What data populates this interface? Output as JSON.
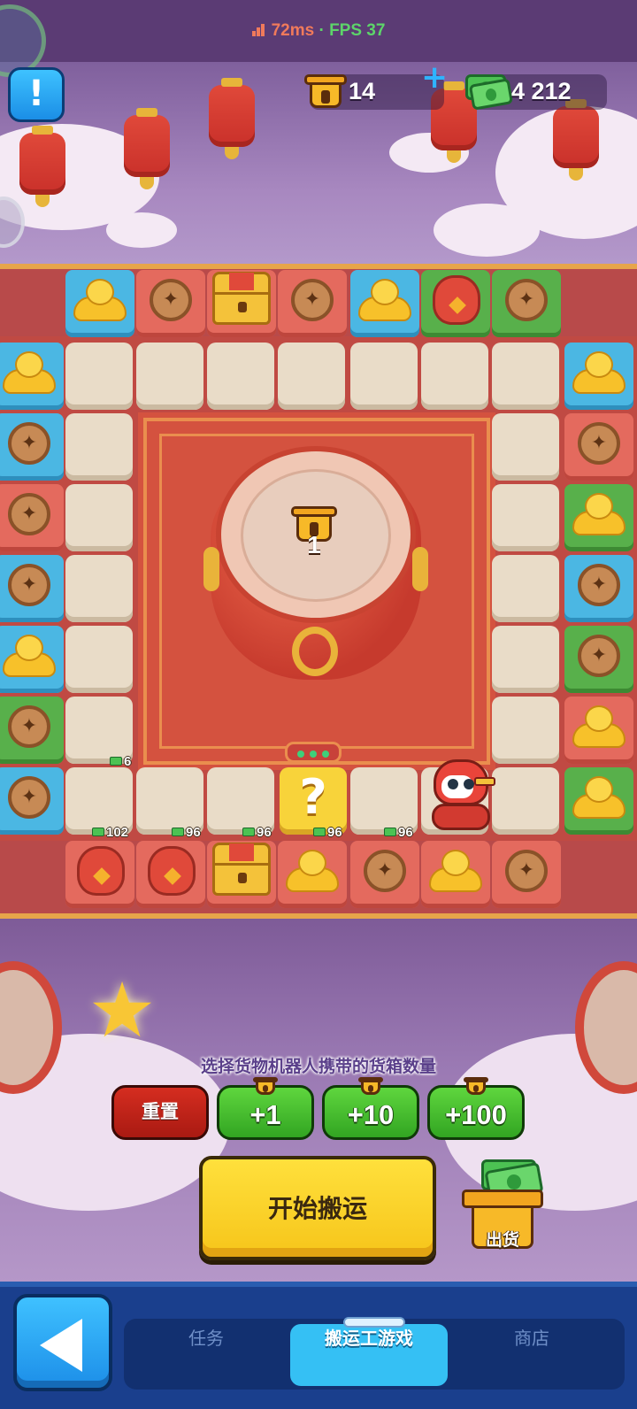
{
  "status": {
    "latency": "72ms",
    "separator": "·",
    "fps": "FPS 37"
  },
  "resources": {
    "baskets": "14",
    "cash": "4 212"
  },
  "board": {
    "center_count": "1",
    "question_tile": "?",
    "prices": {
      "left_col": "6",
      "bottom_1": "102",
      "bottom_2": "96",
      "bottom_3": "96",
      "bottom_4": "96",
      "bottom_5": "96"
    }
  },
  "controls": {
    "prompt": "选择货物机器人携带的货箱数量",
    "reset": "重置",
    "plus1": "+1",
    "plus10": "+10",
    "plus100": "+100",
    "start": "开始搬运",
    "ship": "出货"
  },
  "nav": {
    "tabs": [
      {
        "label": "任务"
      },
      {
        "label": "搬运工游戏"
      },
      {
        "label": "商店"
      }
    ],
    "active_tab": "搬运工游戏"
  },
  "colors": {
    "accent_blue": "#35c0f4",
    "board_red": "#c04a43",
    "start_yellow": "#f6c51a",
    "button_green": "#32a522",
    "reset_red": "#a91a12"
  }
}
